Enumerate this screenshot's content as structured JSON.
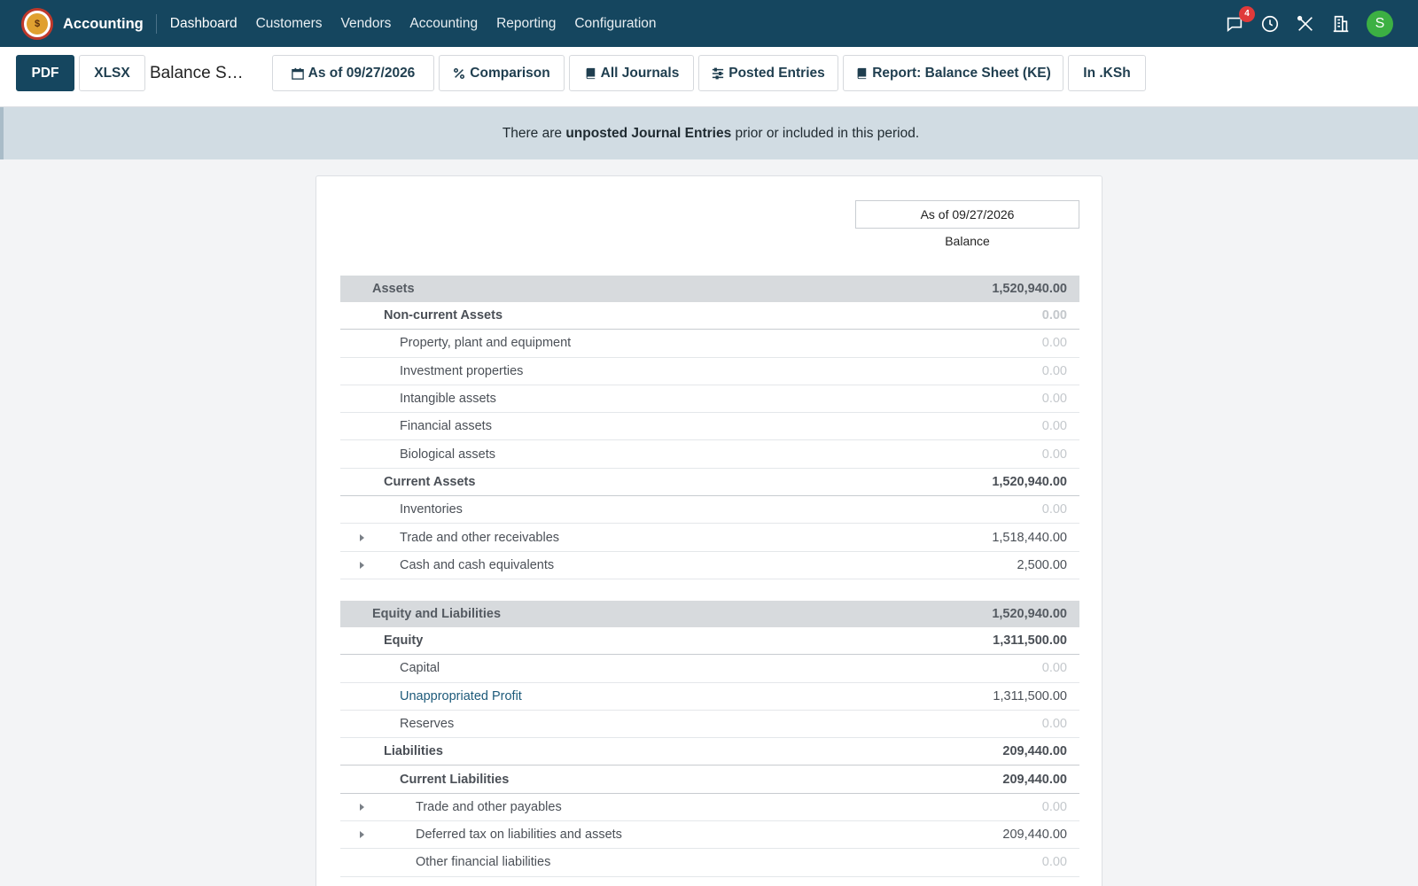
{
  "navbar": {
    "app_name": "Accounting",
    "menu": [
      "Dashboard",
      "Customers",
      "Vendors",
      "Accounting",
      "Reporting",
      "Configuration"
    ],
    "notification_count": "4",
    "avatar_letter": "S"
  },
  "controls": {
    "pdf_label": "PDF",
    "xlsx_label": "XLSX",
    "report_title": "Balance Sheet",
    "date_filter": "As of 09/27/2026",
    "comparison": "Comparison",
    "journals": "All Journals",
    "entries": "Posted Entries",
    "report_variant": "Report: Balance Sheet (KE)",
    "currency": "In .KSh"
  },
  "warning": {
    "prefix": "There are ",
    "bold": "unposted Journal Entries",
    "suffix": " prior or included in this period."
  },
  "report": {
    "column_date": "As of 09/27/2026",
    "column_label": "Balance",
    "rows": [
      {
        "label": "Assets",
        "amount": "1,520,940.00",
        "type": "section",
        "level": 0
      },
      {
        "label": "Non-current Assets",
        "amount": "0.00",
        "type": "group",
        "level": 1
      },
      {
        "label": "Property, plant and equipment",
        "amount": "0.00",
        "type": "line",
        "level": 2
      },
      {
        "label": "Investment properties",
        "amount": "0.00",
        "type": "line",
        "level": 2
      },
      {
        "label": "Intangible assets",
        "amount": "0.00",
        "type": "line",
        "level": 2
      },
      {
        "label": "Financial assets",
        "amount": "0.00",
        "type": "line",
        "level": 2
      },
      {
        "label": "Biological assets",
        "amount": "0.00",
        "type": "line",
        "level": 2
      },
      {
        "label": "Current Assets",
        "amount": "1,520,940.00",
        "type": "group",
        "level": 1
      },
      {
        "label": "Inventories",
        "amount": "0.00",
        "type": "line",
        "level": 2
      },
      {
        "label": "Trade and other receivables",
        "amount": "1,518,440.00",
        "type": "line",
        "level": 2,
        "expandable": true
      },
      {
        "label": "Cash and cash equivalents",
        "amount": "2,500.00",
        "type": "line",
        "level": 2,
        "expandable": true
      },
      {
        "type": "gap"
      },
      {
        "label": "Equity and Liabilities",
        "amount": "1,520,940.00",
        "type": "section",
        "level": 0
      },
      {
        "label": "Equity",
        "amount": "1,311,500.00",
        "type": "group",
        "level": 1
      },
      {
        "label": "Capital",
        "amount": "0.00",
        "type": "line",
        "level": 2
      },
      {
        "label": "Unappropriated Profit",
        "amount": "1,311,500.00",
        "type": "line",
        "level": 2,
        "link": true
      },
      {
        "label": "Reserves",
        "amount": "0.00",
        "type": "line",
        "level": 2
      },
      {
        "label": "Liabilities",
        "amount": "209,440.00",
        "type": "group",
        "level": 1
      },
      {
        "label": "Current Liabilities",
        "amount": "209,440.00",
        "type": "group",
        "level": 2
      },
      {
        "label": "Trade and other payables",
        "amount": "0.00",
        "type": "line",
        "level": 3,
        "expandable": true
      },
      {
        "label": "Deferred tax on liabilities and assets",
        "amount": "209,440.00",
        "type": "line",
        "level": 3,
        "expandable": true
      },
      {
        "label": "Other financial liabilities",
        "amount": "0.00",
        "type": "line",
        "level": 3
      }
    ]
  }
}
